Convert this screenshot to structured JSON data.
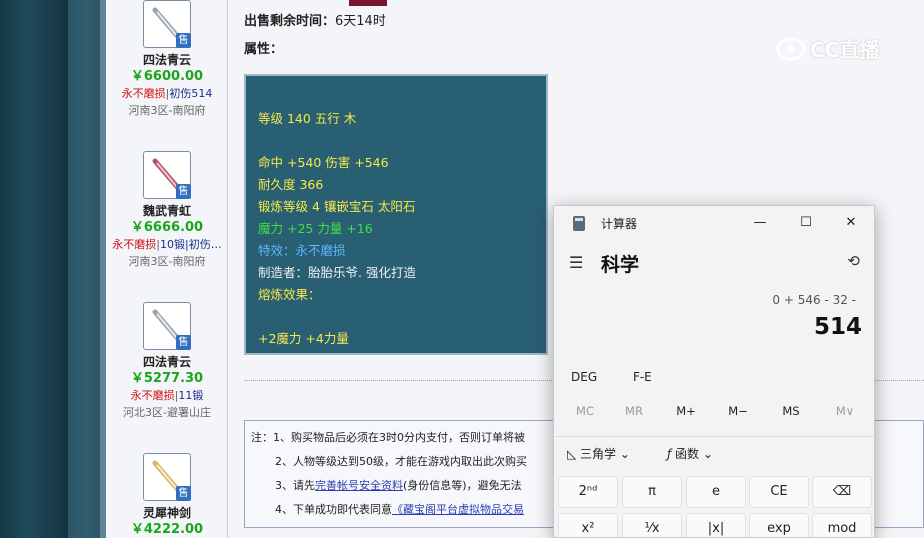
{
  "sidebar": {
    "items": [
      {
        "name": "四法青云",
        "price": "￥6600.00",
        "tag_red": "永不磨损",
        "tag_blue": "初伤514",
        "server": "河南3区-南阳府",
        "sell": "售"
      },
      {
        "name": "魏武青虹",
        "price": "￥6666.00",
        "tag_red": "永不磨损",
        "tag_blue": "10锻|初伤…",
        "server": "河南3区-南阳府",
        "sell": "售"
      },
      {
        "name": "四法青云",
        "price": "￥5277.30",
        "tag_red": "永不磨损",
        "tag_blue": "11锻",
        "server": "河北3区-避署山庄",
        "sell": "售"
      },
      {
        "name": "灵犀神剑",
        "price": "￥4222.00",
        "tag_red": "",
        "tag_blue": "",
        "server": "",
        "sell": "售"
      }
    ]
  },
  "main": {
    "time_label": "出售剩余时间：",
    "time_value": "6天14时",
    "attr_label": "属性：",
    "attr_lines": [
      "等级 140 五行 木",
      "",
      "命中 +540 伤害 +546",
      "耐久度 366",
      "锻炼等级 4 镶嵌宝石 太阳石",
      "魔力 +25 力量 +16",
      "特效：永不磨损",
      "制造者：胎胎乐爷. 强化打造",
      "熔炼效果：",
      "",
      "+2魔力 +4力量"
    ],
    "notice": {
      "line1": "注：1、购买物品后必须在3时0分内支付，否则订单将被",
      "line2": "2、人物等级达到50级，才能在游戏内取出此次购买",
      "line3_pre": "3、请先",
      "line3_link": "完善帐号安全资料",
      "line3_post": "(身份信息等)，避免无法",
      "line4_pre": "4、下单成功即代表同意",
      "line4_link": "《藏宝阁平台虚拟物品交易"
    }
  },
  "watermark": "CC直播",
  "calculator": {
    "app_title": "计算器",
    "minimize": "—",
    "maximize": "☐",
    "close": "✕",
    "mode": "科学",
    "expression": "0 + 546 - 32 -",
    "result": "514",
    "angle_mode": "DEG",
    "fe": "F-E",
    "memory": [
      "MC",
      "MR",
      "M+",
      "M−",
      "MS",
      "M∨"
    ],
    "trig": "三角学",
    "func": "函数",
    "keys_row1": [
      "2ⁿᵈ",
      "π",
      "e",
      "CE",
      "⌫"
    ],
    "keys_row2": [
      "x²",
      "¹⁄x",
      "|x|",
      "exp",
      "mod"
    ]
  }
}
